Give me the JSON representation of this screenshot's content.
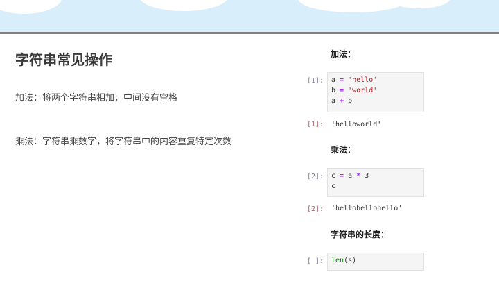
{
  "slide": {
    "title": "字符串常见操作",
    "paragraphs": [
      "加法：将两个字符串相加，中间没有空格",
      "乘法：字符串乘数字，将字符串中的内容重复特定次数"
    ]
  },
  "notebook": {
    "headings": [
      "加法：",
      "乘法：",
      "字符串的长度："
    ],
    "cells": [
      {
        "in_prompt": "[1]:",
        "lines": [
          [
            {
              "t": "a "
            },
            {
              "t": "=",
              "c": "op"
            },
            {
              "t": " "
            },
            {
              "t": "'hello'",
              "c": "str"
            }
          ],
          [
            {
              "t": "b "
            },
            {
              "t": "=",
              "c": "op"
            },
            {
              "t": " "
            },
            {
              "t": "'world'",
              "c": "str"
            }
          ],
          [
            {
              "t": "a "
            },
            {
              "t": "+",
              "c": "op"
            },
            {
              "t": " b"
            }
          ]
        ],
        "out_prompt": "[1]:",
        "output": "'helloworld'"
      },
      {
        "in_prompt": "[2]:",
        "lines": [
          [
            {
              "t": "c "
            },
            {
              "t": "=",
              "c": "op"
            },
            {
              "t": " a "
            },
            {
              "t": "*",
              "c": "op"
            },
            {
              "t": " 3"
            }
          ],
          [
            {
              "t": "c"
            }
          ]
        ],
        "out_prompt": "[2]:",
        "output": "'hellohellohello'"
      },
      {
        "in_prompt": "[ ]:",
        "lines": [
          [
            {
              "t": "len",
              "c": "fn"
            },
            {
              "t": "(s)"
            }
          ]
        ],
        "out_prompt": "",
        "output": ""
      }
    ]
  }
}
